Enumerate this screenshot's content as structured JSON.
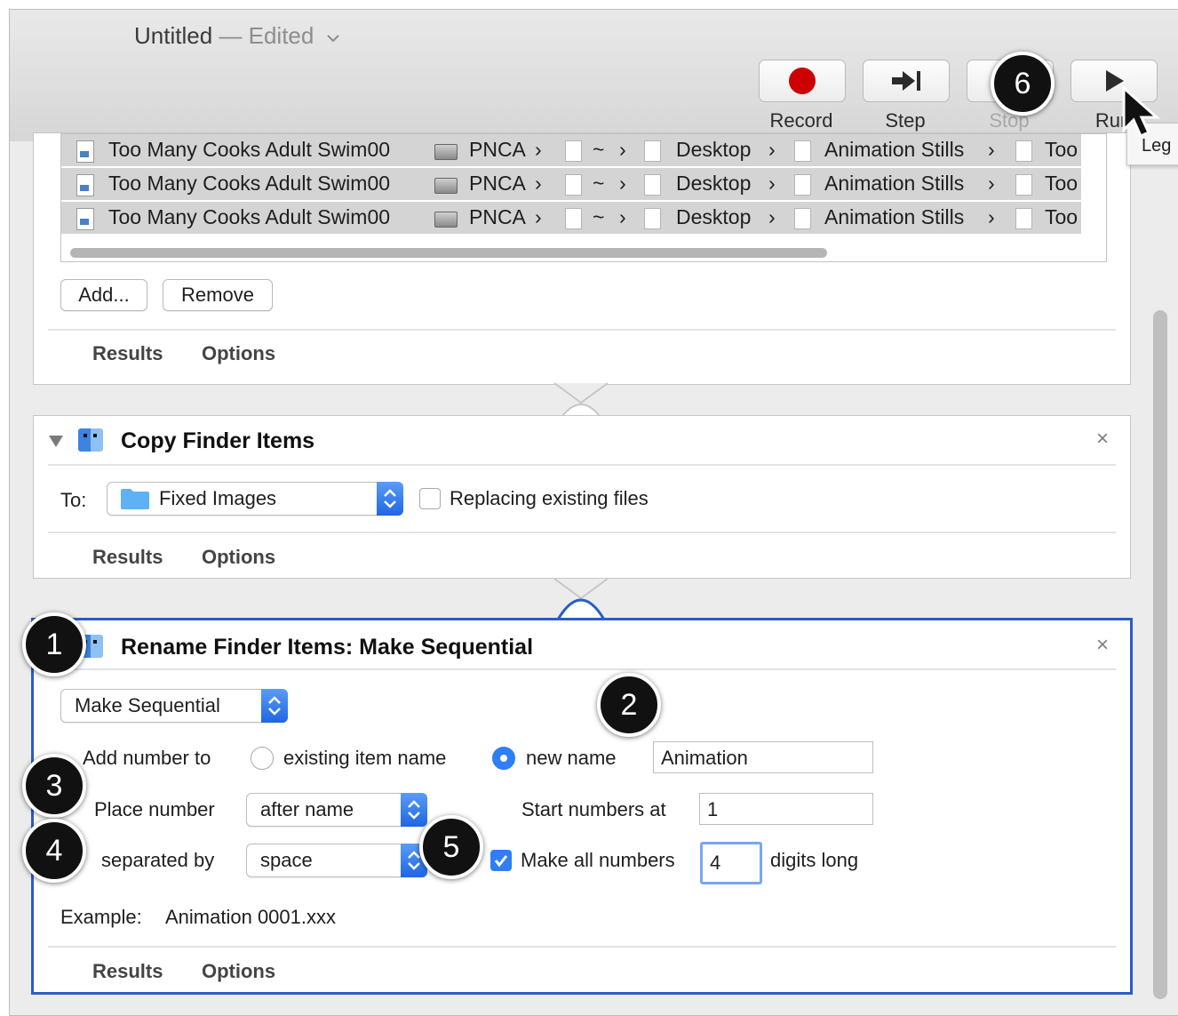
{
  "window": {
    "title": "Untitled",
    "title_separator": " — ",
    "title_state": "Edited"
  },
  "toolbar": {
    "record_label": "Record",
    "step_label": "Step",
    "stop_label": "Stop",
    "run_label": "Run",
    "tooltip_partial": "Leg",
    "record_color": "#cc0000"
  },
  "file_list": {
    "rows": [
      {
        "name": "Too Many Cooks Adult Swim00",
        "path": [
          "PNCA",
          "~",
          "Desktop",
          "Animation Stills",
          "Too"
        ]
      },
      {
        "name": "Too Many Cooks Adult Swim00",
        "path": [
          "PNCA",
          "~",
          "Desktop",
          "Animation Stills",
          "Too"
        ]
      },
      {
        "name": "Too Many Cooks Adult Swim00",
        "path": [
          "PNCA",
          "~",
          "Desktop",
          "Animation Stills",
          "Too"
        ]
      }
    ],
    "path_separator": "›",
    "add_label": "Add...",
    "remove_label": "Remove"
  },
  "panel1": {
    "results_tab": "Results",
    "options_tab": "Options"
  },
  "copy_panel": {
    "title": "Copy Finder Items",
    "to_label": "To:",
    "destination": "Fixed Images",
    "replacing_label": "Replacing existing files",
    "replacing_checked": false,
    "results_tab": "Results",
    "options_tab": "Options",
    "close_glyph": "×"
  },
  "rename_panel": {
    "title": "Rename Finder Items: Make Sequential",
    "mode": "Make Sequential",
    "add_number_label": "Add number to",
    "existing_name_label": "existing item name",
    "new_name_label": "new name",
    "new_name_value": "Animation",
    "selected_option": "new name",
    "place_number_label": "Place number",
    "place_number_value": "after name",
    "start_numbers_label": "Start numbers at",
    "start_numbers_value": "1",
    "separated_by_label": "separated by",
    "separated_by_value": "space",
    "make_all_numbers_label": "Make all numbers",
    "make_all_numbers_checked": true,
    "digits_value": "4",
    "digits_long_label": "digits long",
    "example_label": "Example:",
    "example_value": "Animation 0001.xxx",
    "results_tab": "Results",
    "options_tab": "Options",
    "close_glyph": "×",
    "accent_color": "#2a5cc8"
  },
  "badges": [
    "1",
    "2",
    "3",
    "4",
    "5",
    "6"
  ]
}
